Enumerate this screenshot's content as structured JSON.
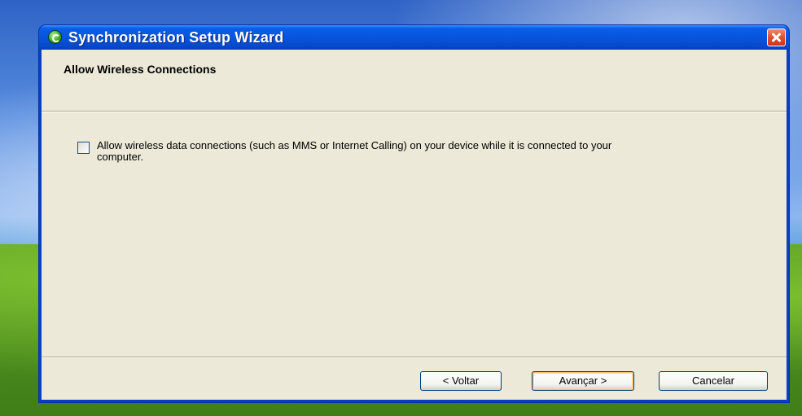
{
  "window": {
    "title": "Synchronization Setup Wizard"
  },
  "page": {
    "heading": "Allow Wireless Connections",
    "checkbox": {
      "label": "Allow wireless data connections (such as MMS or Internet Calling) on your device while it is connected to your computer.",
      "checked": false
    }
  },
  "buttons": {
    "back": "< Voltar",
    "next": "Avançar >",
    "cancel": "Cancelar"
  },
  "icons": {
    "app": "sync-app-icon",
    "close": "close-icon"
  },
  "colors": {
    "titlebar": "#0755de",
    "client_background": "#ece9d8",
    "close_button": "#e0502c"
  }
}
